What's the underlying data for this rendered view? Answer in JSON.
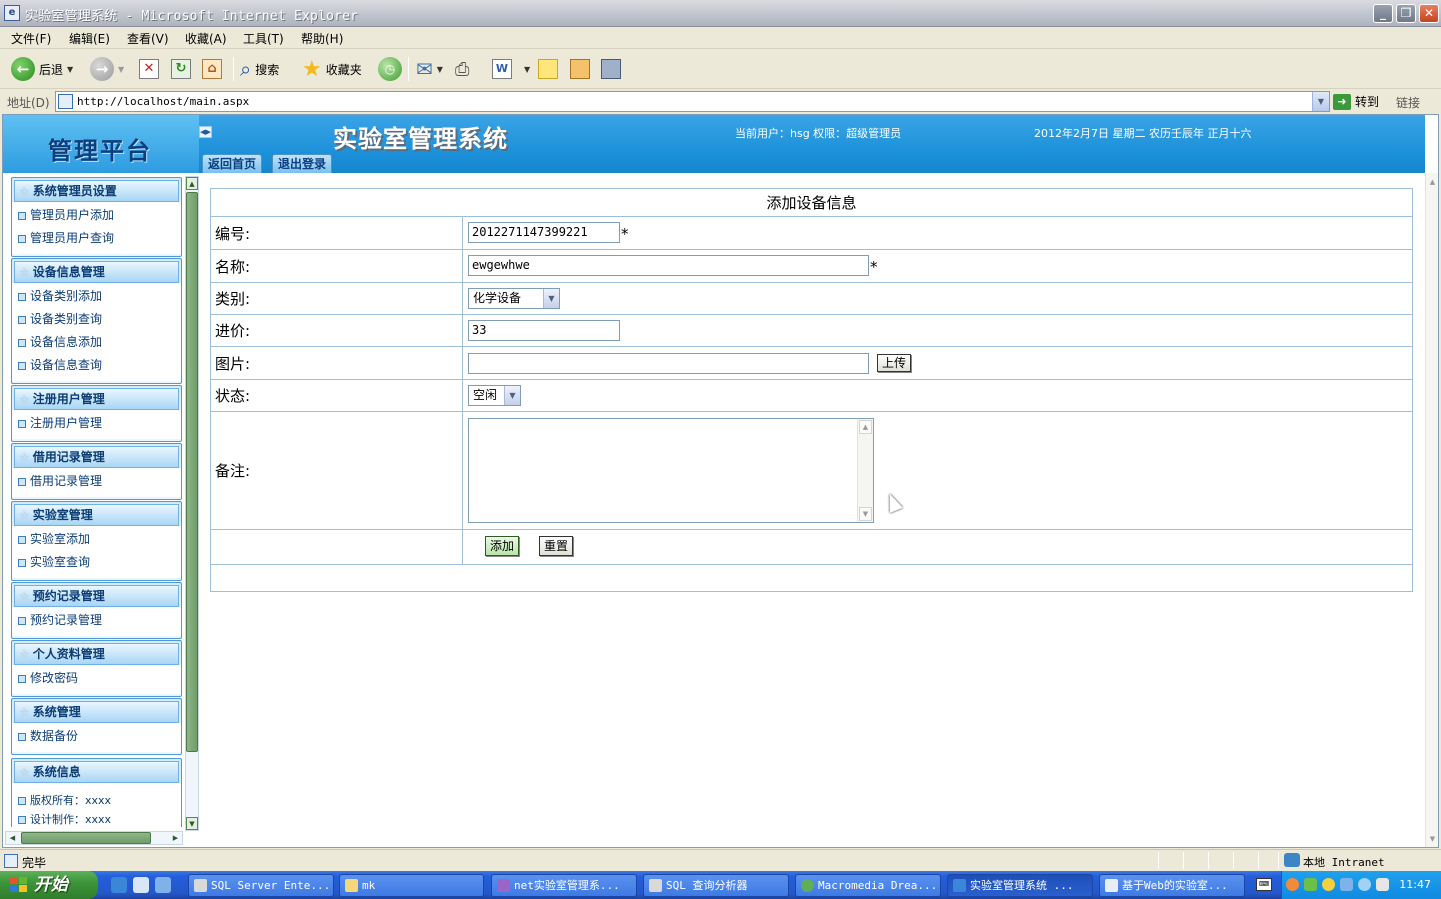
{
  "window": {
    "title": "实验室管理系统 - Microsoft Internet Explorer",
    "app_icon": "ie-page-icon"
  },
  "menu": [
    "文件(F)",
    "编辑(E)",
    "查看(V)",
    "收藏(A)",
    "工具(T)",
    "帮助(H)"
  ],
  "toolbar": {
    "back_label": "后退",
    "search_label": "搜索",
    "favorites_label": "收藏夹"
  },
  "address": {
    "label": "地址(D)",
    "url": "http://localhost/main.aspx",
    "go_label": "转到",
    "links_label": "链接"
  },
  "page": {
    "logo_text": "管理平台",
    "system_title": "实验室管理系统",
    "current_user": "当前用户：hsg 权限：超级管理员",
    "date": "2012年2月7日 星期二 农历壬辰年 正月十六",
    "nav": {
      "home": "返回首页",
      "logout": "退出登录"
    }
  },
  "sidebar": {
    "groups": [
      {
        "title": "系统管理员设置",
        "items": [
          "管理员用户添加",
          "管理员用户查询"
        ]
      },
      {
        "title": "设备信息管理",
        "items": [
          "设备类别添加",
          "设备类别查询",
          "设备信息添加",
          "设备信息查询"
        ]
      },
      {
        "title": "注册用户管理",
        "items": [
          "注册用户管理"
        ]
      },
      {
        "title": "借用记录管理",
        "items": [
          "借用记录管理"
        ]
      },
      {
        "title": "实验室管理",
        "items": [
          "实验室添加",
          "实验室查询"
        ]
      },
      {
        "title": "预约记录管理",
        "items": [
          "预约记录管理"
        ]
      },
      {
        "title": "个人资料管理",
        "items": [
          "修改密码"
        ]
      },
      {
        "title": "系统管理",
        "items": [
          "数据备份"
        ]
      },
      {
        "title": "系统信息",
        "items": [
          "版权所有：xxxx",
          "设计制作：xxxx"
        ]
      }
    ]
  },
  "form": {
    "title": "添加设备信息",
    "fields": {
      "id": {
        "label": "编号:",
        "value": "2012271147399221",
        "required": "*"
      },
      "name": {
        "label": "名称:",
        "value": "ewgewhwe",
        "required": "*"
      },
      "category": {
        "label": "类别:",
        "selected": "化学设备"
      },
      "price": {
        "label": "进价:",
        "value": "33"
      },
      "image": {
        "label": "图片:",
        "value": "",
        "upload_label": "上传"
      },
      "status": {
        "label": "状态:",
        "selected": "空闲"
      },
      "remark": {
        "label": "备注:",
        "value": ""
      }
    },
    "add_label": "添加",
    "reset_label": "重置"
  },
  "statusbar": {
    "status": "完毕",
    "zone": "本地 Intranet"
  },
  "taskbar": {
    "start_label": "开始",
    "tasks": [
      "SQL Server Ente...",
      "mk",
      "net实验室管理系...",
      "SQL 查询分析器",
      "Macromedia Drea...",
      "实验室管理系统 ...",
      "基于Web的实验室..."
    ],
    "clock": "11:47"
  }
}
